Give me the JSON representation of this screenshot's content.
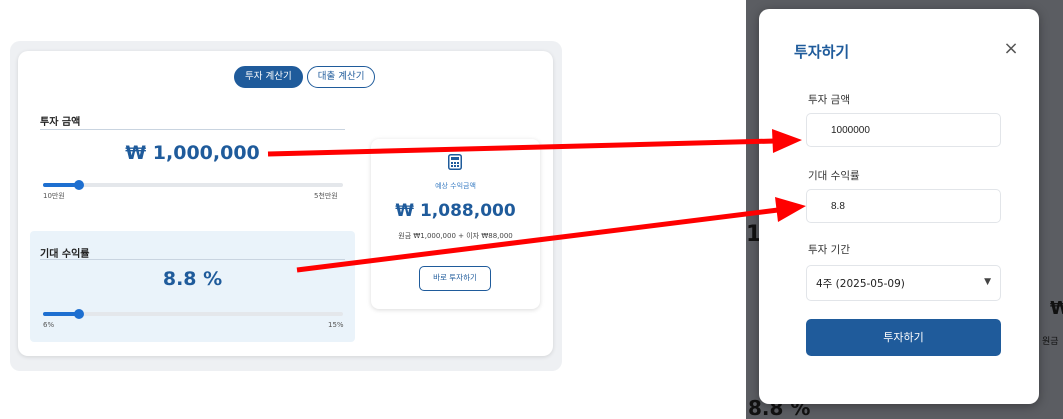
{
  "calculator": {
    "tabs": [
      {
        "label": "투자 계산기",
        "active": true
      },
      {
        "label": "대출 계산기",
        "active": false
      }
    ],
    "investment": {
      "label": "투자 금액",
      "amount_display": "₩ 1,000,000",
      "slider_min_label": "10만원",
      "slider_max_label": "5천만원",
      "slider_fraction": 0.12
    },
    "rate": {
      "label": "기대 수익률",
      "value_display": "8.8 %",
      "slider_min_label": "6%",
      "slider_max_label": "15%",
      "slider_fraction": 0.12
    },
    "result": {
      "label": "예상 수익금액",
      "amount": "₩ 1,088,000",
      "breakdown": "원금 ₩1,000,000 + 이자 ₩88,000",
      "button_label": "바로 투자하기"
    }
  },
  "modal": {
    "title": "투자하기",
    "close_glyph": "×",
    "amount_label": "투자 금액",
    "amount_value": "1000000",
    "rate_label": "기대 수익률",
    "rate_value": "8.8",
    "period_label": "투자 기간",
    "period_value": "4주 (2025-05-09)",
    "submit_label": "투자하기"
  },
  "background_fragments": {
    "left_edge_text": "1,",
    "bottom_text": "8.8 %",
    "right_symbol": "₩",
    "right_text": "원금"
  },
  "colors": {
    "primary": "#1f5b9b",
    "slider": "#1e6fd0",
    "arrow": "#ff0000",
    "rate_box": "#eaf3fa"
  },
  "icons": {
    "calculator": "calculator-icon",
    "close": "close-icon",
    "dropdown": "caret-down-icon"
  }
}
